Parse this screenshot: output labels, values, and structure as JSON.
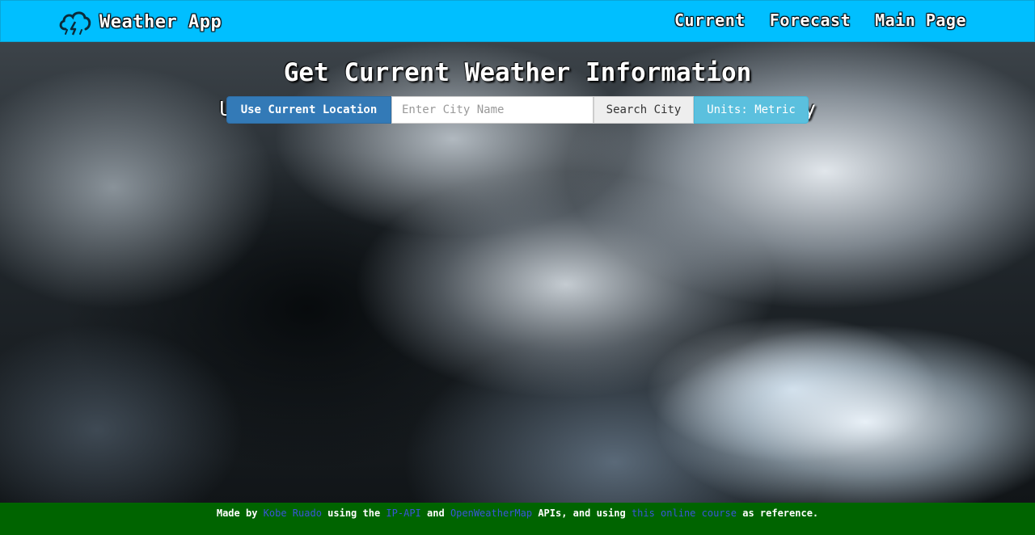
{
  "navbar": {
    "brand": "Weather App",
    "brand_icon": "cloud-lightning-icon",
    "links": [
      "Current",
      "Forecast",
      "Main Page"
    ],
    "background_color": "#00bfff"
  },
  "main": {
    "title": "Get Current Weather Information",
    "subtitle": "Use your own location, or search for another city",
    "use_location_label": "Use Current Location",
    "city_placeholder": "Enter City Name",
    "city_value": "",
    "search_label": "Search City",
    "units_label": "Units: Metric"
  },
  "footer": {
    "made_by": "Made by",
    "author": "Kobe Ruado",
    "using_the": "using the",
    "api1": "IP-API",
    "and": "and",
    "api2": "OpenWeatherMap",
    "apis_using": "APIs, and using",
    "course": "this online course",
    "as_reference": "as reference.",
    "background_color": "#006400"
  }
}
